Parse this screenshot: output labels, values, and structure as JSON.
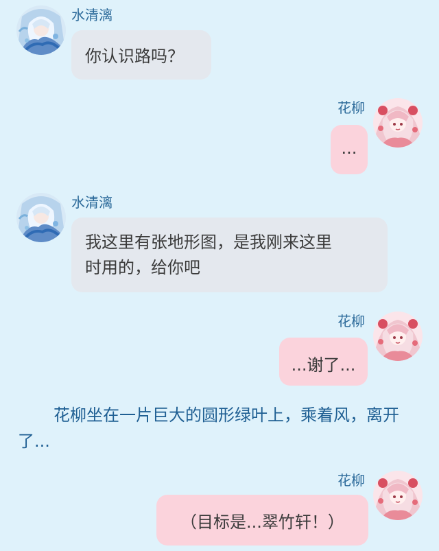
{
  "characters": {
    "left": {
      "name": "水清漓",
      "avatar_icon": "character-avatar-blue-icon"
    },
    "right": {
      "name": "花柳",
      "avatar_icon": "character-avatar-pink-icon"
    }
  },
  "messages": [
    {
      "side": "left",
      "speaker": "水清漓",
      "text": "你认识路吗？"
    },
    {
      "side": "right",
      "speaker": "花柳",
      "text": "..."
    },
    {
      "side": "left",
      "speaker": "水清漓",
      "lines": [
        "我这里有张地形图，是我刚来这里",
        "时用的，给你吧"
      ]
    },
    {
      "side": "right",
      "speaker": "花柳",
      "text": "...谢了..."
    }
  ],
  "narration": "花柳坐在一片巨大的圆形绿叶上，乘着风，离开了...",
  "final_message": {
    "side": "right",
    "speaker": "花柳",
    "text": "（目标是...翠竹轩！）"
  },
  "colors": {
    "background": "#dff2fb",
    "left_bubble": "#e4e8ee",
    "right_bubble": "#fbd3dc",
    "name_text": "#2c6a9a",
    "narration_text": "#1f5f93"
  }
}
